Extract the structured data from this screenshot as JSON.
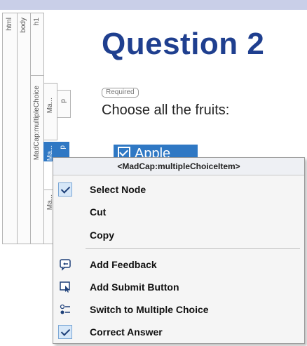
{
  "structure_bar": {
    "tags": {
      "html": "html",
      "body": "body",
      "h1": "h1",
      "multiple_choice": "MadCap:multipleChoice",
      "ma1": "Ma...",
      "p1": "p",
      "ma2": "Ma...",
      "p2": "p",
      "ma3": "Ma..."
    }
  },
  "document": {
    "title": "Question 2",
    "required_badge": "Required",
    "prompt": "Choose all the fruits:",
    "option_label": "Apple"
  },
  "context_menu": {
    "header": "<MadCap:multipleChoiceItem>",
    "items": [
      {
        "label": "Select Node",
        "icon": "checkmark-icon",
        "checked": true
      },
      {
        "label": "Cut",
        "icon": "",
        "checked": false
      },
      {
        "label": "Copy",
        "icon": "",
        "checked": false
      },
      {
        "label": "Add Feedback",
        "icon": "add-feedback-icon",
        "checked": false
      },
      {
        "label": "Add Submit Button",
        "icon": "add-submit-button-icon",
        "checked": false
      },
      {
        "label": "Switch to Multiple Choice",
        "icon": "multiple-choice-icon",
        "checked": false
      },
      {
        "label": "Correct Answer",
        "icon": "checkmark-icon",
        "checked": true
      }
    ]
  },
  "colors": {
    "title": "#1f3f8f",
    "selection": "#2f78c4",
    "top_bar": "#c9cfe8"
  }
}
